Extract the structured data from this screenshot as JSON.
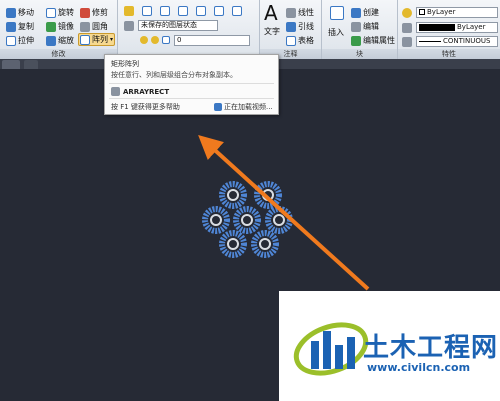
{
  "ribbon": {
    "modify": {
      "title": "修改",
      "move": "移动",
      "rotate": "旋转",
      "trim": "修剪",
      "copy": "复制",
      "mirror": "镜像",
      "fillet": "圆角",
      "stretch": "拉伸",
      "scale": "缩放",
      "array": "阵列"
    },
    "layers": {
      "state_combo": "未保存的图层状态",
      "layer_combo": "0"
    },
    "annotation": {
      "title": "注释",
      "text": "文字",
      "linear": "线性",
      "leader": "引线",
      "table": "表格"
    },
    "block": {
      "title": "块",
      "insert": "插入",
      "create": "创建",
      "edit": "编辑",
      "edit_attr": "编辑属性"
    },
    "properties": {
      "title": "特性",
      "color": "ByLayer",
      "lineweight": "ByLayer",
      "linetype": "CONTINUOUS"
    }
  },
  "tooltip": {
    "title": "矩形阵列",
    "description": "按任意行、列和层级组合分布对象副本。",
    "command": "ARRAYRECT",
    "help": "按 F1 键获得更多帮助",
    "video": "正在加载视频..."
  },
  "watermark": {
    "title": "土木工程网",
    "url": "www.civilcn.com"
  },
  "colors": {
    "canvas": "#262a35",
    "arrow": "#f07a1e",
    "ring_outer": "#4f86d6",
    "ring_inner": "#d9dde3",
    "brand": "#1b62b3"
  }
}
